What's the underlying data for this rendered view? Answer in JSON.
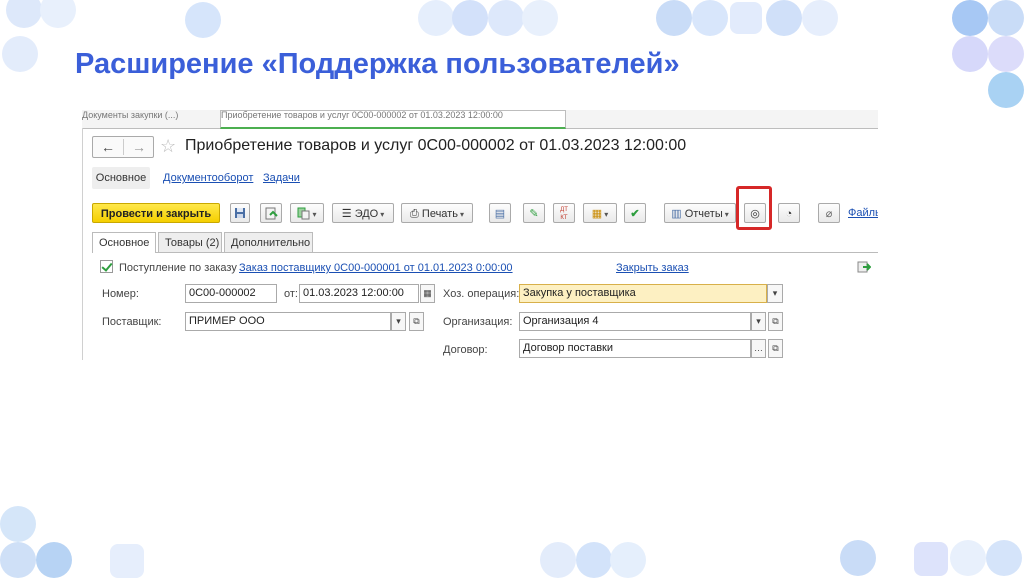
{
  "slide": {
    "title": "Расширение «Поддержка пользователей»"
  },
  "colors": {
    "title": "#3b5fd9",
    "highlight": "#d62828",
    "primary_button": "#f5cf00",
    "link": "#1a4fb3",
    "yellow_field": "#fdf0c2",
    "dots": "#c9dcf7"
  },
  "window": {
    "tab_inactive": "Документы закупки (...)",
    "tab_active": "Приобретение товаров и услуг 0С00-000002 от 01.03.2023 12:00:00",
    "nav_back": "←",
    "nav_forward": "→",
    "favorite_icon": "star-icon",
    "doc_title": "Приобретение товаров и услуг 0С00-000002 от 01.03.2023 12:00:00"
  },
  "sections": {
    "main": "Основное",
    "docflow": "Документооборот",
    "tasks": "Задачи"
  },
  "toolbar": {
    "post_close": "Провести и закрыть",
    "edo": "ЭДО",
    "print": "Печать",
    "reports": "Отчеты",
    "dt_kt": "ДТ\nКТ",
    "files": "Файлы",
    "icons": [
      "save-icon",
      "post-icon",
      "create-based-icon",
      "edo-icon",
      "print-icon",
      "journal-icon",
      "sign-icon",
      "dtkt-icon",
      "attachment-menu-icon",
      "check-icon",
      "reports-icon",
      "support-icon",
      "support-history-icon",
      "paperclip-icon"
    ]
  },
  "form_tabs": {
    "main": "Основное",
    "goods": "Товары (2)",
    "extra": "Дополнительно"
  },
  "form": {
    "order_checkbox_label": "Поступление по заказу",
    "order_checked": true,
    "order_link": "Заказ поставщику 0С00-000001 от 01.01.2023 0:00:00",
    "close_order_link": "Закрыть заказ",
    "number_label": "Номер:",
    "number_value": "0С00-000002",
    "from_label": "от:",
    "date_value": "01.03.2023 12:00:00",
    "operation_label": "Хоз. операция:",
    "operation_value": "Закупка у поставщика",
    "supplier_label": "Поставщик:",
    "supplier_value": "ПРИМЕР ООО",
    "org_label": "Организация:",
    "org_value": "Организация 4",
    "contract_label": "Договор:",
    "contract_value": "Договор поставки"
  }
}
